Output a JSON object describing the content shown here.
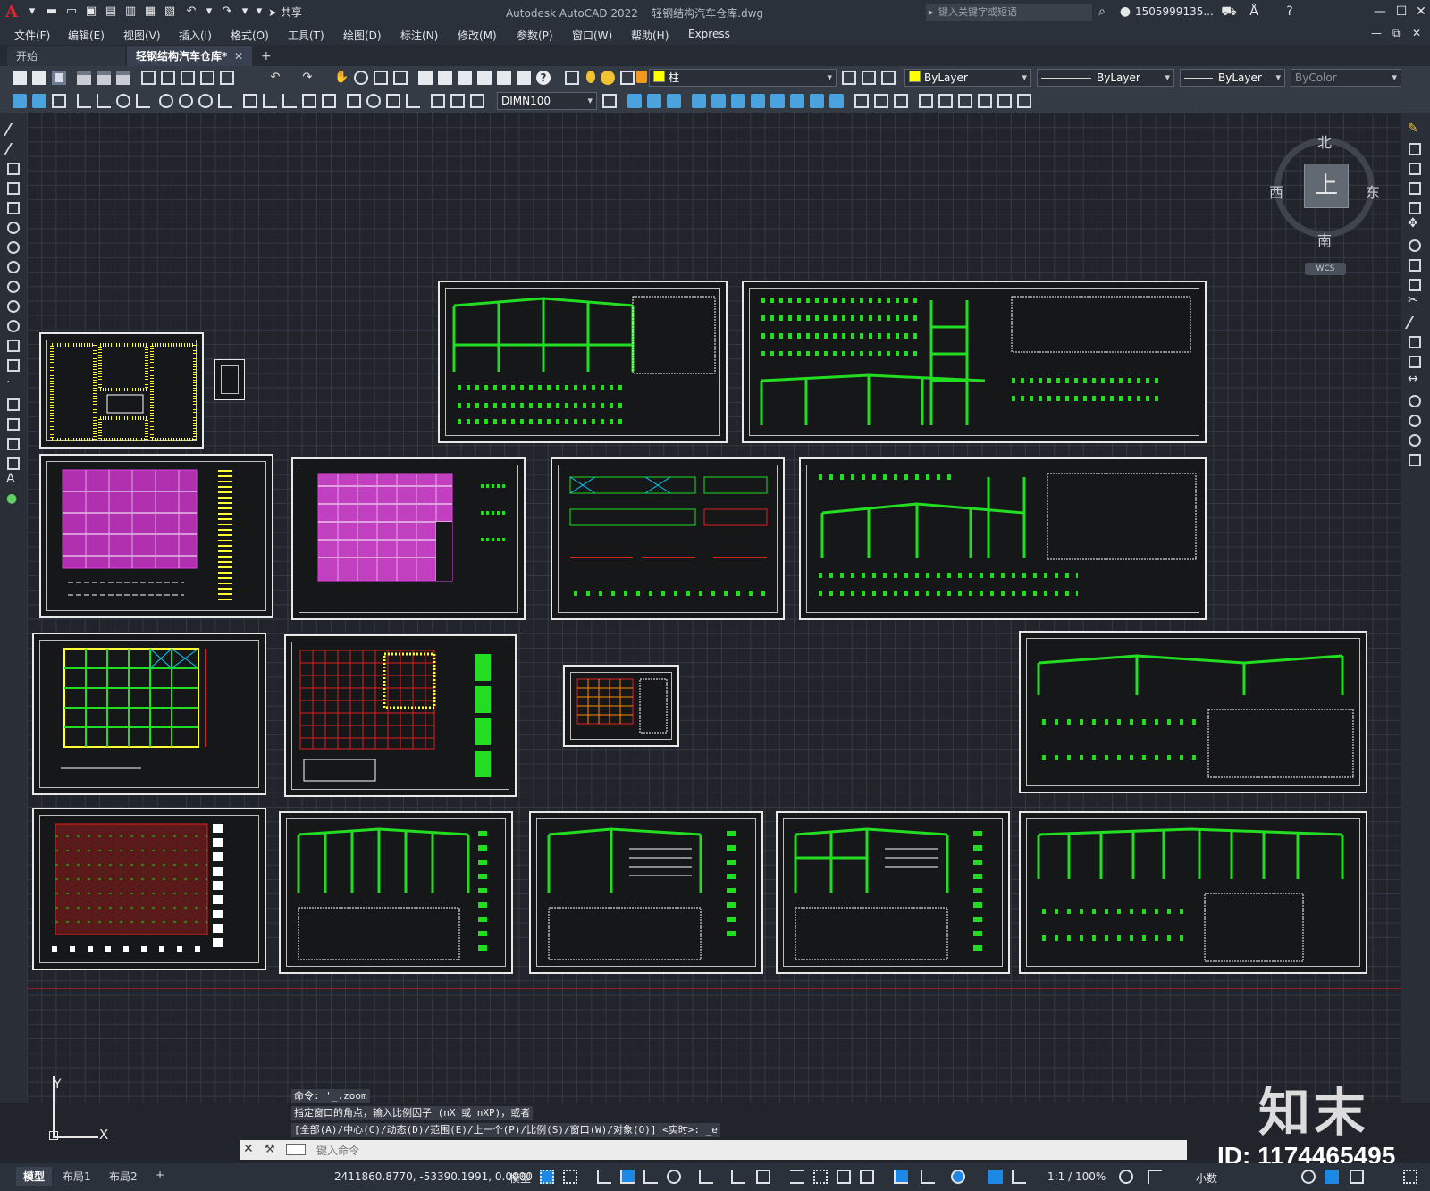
{
  "titlebar": {
    "app_name": "Autodesk AutoCAD 2022",
    "file_name": "轻钢结构汽车仓库.dwg",
    "share_label": "共享",
    "search_placeholder": "键入关键字或短语",
    "user_name": "1505999135..."
  },
  "menu": {
    "items": [
      "文件(F)",
      "编辑(E)",
      "视图(V)",
      "插入(I)",
      "格式(O)",
      "工具(T)",
      "绘图(D)",
      "标注(N)",
      "修改(M)",
      "参数(P)",
      "窗口(W)",
      "帮助(H)",
      "Express"
    ]
  },
  "tabs": {
    "start": "开始",
    "active_file": "轻钢结构汽车仓库*"
  },
  "toolbar": {
    "layer_name": "柱",
    "color_value": "ByLayer",
    "linetype_value": "ByLayer",
    "lineweight_value": "ByLayer",
    "plotstyle_value": "ByColor",
    "dimstyle_value": "DIMN100"
  },
  "viewcube": {
    "north": "北",
    "south": "南",
    "east": "东",
    "west": "西",
    "top_face": "上",
    "coord_system": "WCS"
  },
  "ucs": {
    "x_label": "X",
    "y_label": "Y"
  },
  "command": {
    "history": [
      "命令: '_.zoom",
      "指定窗口的角点，输入比例因子 (nX 或 nXP)，或者",
      "[全部(A)/中心(C)/动态(D)/范围(E)/上一个(P)/比例(S)/窗口(W)/对象(O)] <实时>: _e"
    ],
    "input_placeholder": "键入命令"
  },
  "statusbar": {
    "layout_tabs": [
      "模型",
      "布局1",
      "布局2"
    ],
    "coordinates": "2411860.8770, -53390.1991, 0.0000",
    "model_label": "模型",
    "scale_label": "1:1 / 100%",
    "units_label": "小数"
  },
  "brand": {
    "text": "知末",
    "id": "ID: 1174465495"
  },
  "colors": {
    "drawing_bg": "#21242b",
    "layer_swatch": "#ffff00",
    "structure_green": "#22dd22",
    "roof_magenta": "#e040e0",
    "grid_red": "#dd2222",
    "notes_yellow": "#ffff33"
  }
}
